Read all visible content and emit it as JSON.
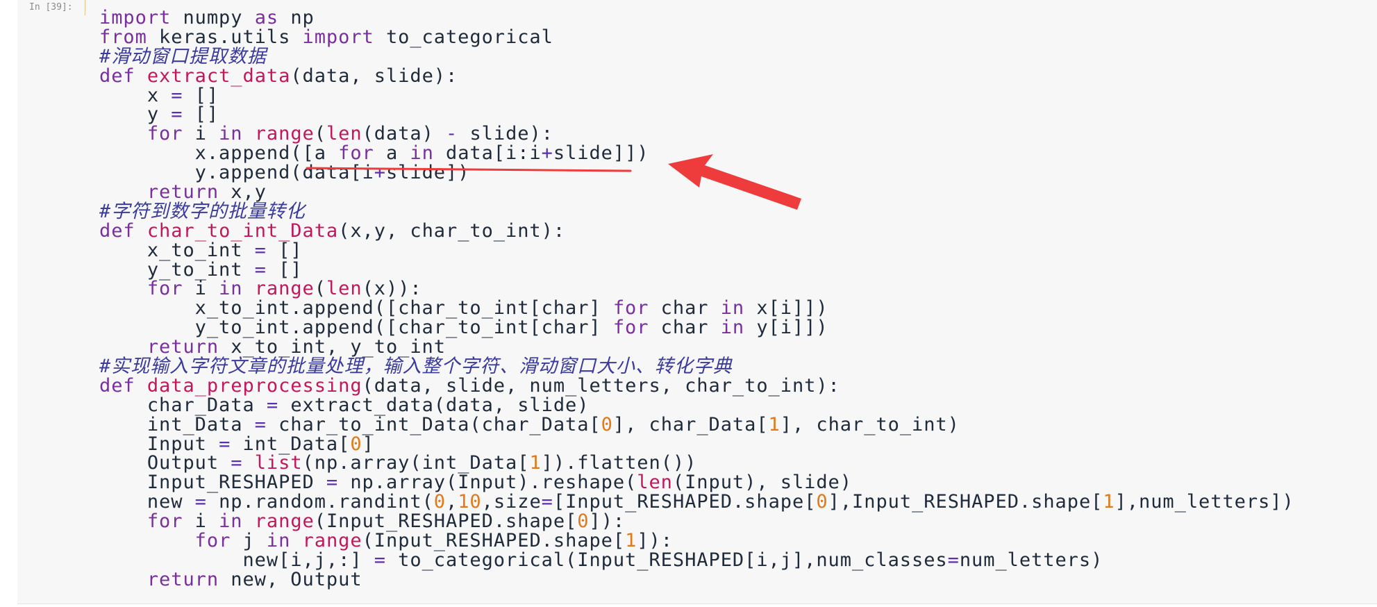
{
  "cell": {
    "prompt": "In [39]:"
  },
  "code_lines": [
    [
      {
        "t": "kw",
        "s": "import"
      },
      {
        "t": "",
        "s": " numpy "
      },
      {
        "t": "kw",
        "s": "as"
      },
      {
        "t": "",
        "s": " np"
      }
    ],
    [
      {
        "t": "kw",
        "s": "from"
      },
      {
        "t": "",
        "s": " keras.utils "
      },
      {
        "t": "kw",
        "s": "import"
      },
      {
        "t": "",
        "s": " to_categorical"
      }
    ],
    [
      {
        "t": "cm",
        "s": "#滑动窗口提取数据"
      }
    ],
    [
      {
        "t": "kw",
        "s": "def"
      },
      {
        "t": "",
        "s": " "
      },
      {
        "t": "fn",
        "s": "extract_data"
      },
      {
        "t": "",
        "s": "(data, slide):"
      }
    ],
    [
      {
        "t": "",
        "s": "    x "
      },
      {
        "t": "op",
        "s": "="
      },
      {
        "t": "",
        "s": " []"
      }
    ],
    [
      {
        "t": "",
        "s": "    y "
      },
      {
        "t": "op",
        "s": "="
      },
      {
        "t": "",
        "s": " []"
      }
    ],
    [
      {
        "t": "",
        "s": "    "
      },
      {
        "t": "kw",
        "s": "for"
      },
      {
        "t": "",
        "s": " i "
      },
      {
        "t": "kw",
        "s": "in"
      },
      {
        "t": "",
        "s": " "
      },
      {
        "t": "bi",
        "s": "range"
      },
      {
        "t": "",
        "s": "("
      },
      {
        "t": "bi",
        "s": "len"
      },
      {
        "t": "",
        "s": "(data) "
      },
      {
        "t": "op",
        "s": "-"
      },
      {
        "t": "",
        "s": " slide):"
      }
    ],
    [
      {
        "t": "",
        "s": "        x.append([a "
      },
      {
        "t": "kw",
        "s": "for"
      },
      {
        "t": "",
        "s": " a "
      },
      {
        "t": "kw",
        "s": "in"
      },
      {
        "t": "",
        "s": " data[i:i"
      },
      {
        "t": "op",
        "s": "+"
      },
      {
        "t": "",
        "s": "slide]])"
      }
    ],
    [
      {
        "t": "",
        "s": "        y.append(data[i"
      },
      {
        "t": "op",
        "s": "+"
      },
      {
        "t": "",
        "s": "slide])"
      }
    ],
    [
      {
        "t": "",
        "s": "    "
      },
      {
        "t": "kw",
        "s": "return"
      },
      {
        "t": "",
        "s": " x,y"
      }
    ],
    [
      {
        "t": "cm",
        "s": "#字符到数字的批量转化"
      }
    ],
    [
      {
        "t": "kw",
        "s": "def"
      },
      {
        "t": "",
        "s": " "
      },
      {
        "t": "fn",
        "s": "char_to_int_Data"
      },
      {
        "t": "",
        "s": "(x,y, char_to_int):"
      }
    ],
    [
      {
        "t": "",
        "s": "    x_to_int "
      },
      {
        "t": "op",
        "s": "="
      },
      {
        "t": "",
        "s": " []"
      }
    ],
    [
      {
        "t": "",
        "s": "    y_to_int "
      },
      {
        "t": "op",
        "s": "="
      },
      {
        "t": "",
        "s": " []"
      }
    ],
    [
      {
        "t": "",
        "s": "    "
      },
      {
        "t": "kw",
        "s": "for"
      },
      {
        "t": "",
        "s": " i "
      },
      {
        "t": "kw",
        "s": "in"
      },
      {
        "t": "",
        "s": " "
      },
      {
        "t": "bi",
        "s": "range"
      },
      {
        "t": "",
        "s": "("
      },
      {
        "t": "bi",
        "s": "len"
      },
      {
        "t": "",
        "s": "(x)):"
      }
    ],
    [
      {
        "t": "",
        "s": "        x_to_int.append([char_to_int[char] "
      },
      {
        "t": "kw",
        "s": "for"
      },
      {
        "t": "",
        "s": " char "
      },
      {
        "t": "kw",
        "s": "in"
      },
      {
        "t": "",
        "s": " x[i]])"
      }
    ],
    [
      {
        "t": "",
        "s": "        y_to_int.append([char_to_int[char] "
      },
      {
        "t": "kw",
        "s": "for"
      },
      {
        "t": "",
        "s": " char "
      },
      {
        "t": "kw",
        "s": "in"
      },
      {
        "t": "",
        "s": " y[i]])"
      }
    ],
    [
      {
        "t": "",
        "s": "    "
      },
      {
        "t": "kw",
        "s": "return"
      },
      {
        "t": "",
        "s": " x_to_int, y_to_int"
      }
    ],
    [
      {
        "t": "cm",
        "s": "#实现输入字符文章的批量处理，输入整个字符、滑动窗口大小、转化字典"
      }
    ],
    [
      {
        "t": "kw",
        "s": "def"
      },
      {
        "t": "",
        "s": " "
      },
      {
        "t": "fn",
        "s": "data_preprocessing"
      },
      {
        "t": "",
        "s": "(data, slide, num_letters, char_to_int):"
      }
    ],
    [
      {
        "t": "",
        "s": "    char_Data "
      },
      {
        "t": "op",
        "s": "="
      },
      {
        "t": "",
        "s": " extract_data(data, slide)"
      }
    ],
    [
      {
        "t": "",
        "s": "    int_Data "
      },
      {
        "t": "op",
        "s": "="
      },
      {
        "t": "",
        "s": " char_to_int_Data(char_Data["
      },
      {
        "t": "num",
        "s": "0"
      },
      {
        "t": "",
        "s": "], char_Data["
      },
      {
        "t": "num",
        "s": "1"
      },
      {
        "t": "",
        "s": "], char_to_int)"
      }
    ],
    [
      {
        "t": "",
        "s": "    Input "
      },
      {
        "t": "op",
        "s": "="
      },
      {
        "t": "",
        "s": " int_Data["
      },
      {
        "t": "num",
        "s": "0"
      },
      {
        "t": "",
        "s": "]"
      }
    ],
    [
      {
        "t": "",
        "s": "    Output "
      },
      {
        "t": "op",
        "s": "="
      },
      {
        "t": "",
        "s": " "
      },
      {
        "t": "bi",
        "s": "list"
      },
      {
        "t": "",
        "s": "(np.array(int_Data["
      },
      {
        "t": "num",
        "s": "1"
      },
      {
        "t": "",
        "s": "]).flatten())"
      }
    ],
    [
      {
        "t": "",
        "s": "    Input_RESHAPED "
      },
      {
        "t": "op",
        "s": "="
      },
      {
        "t": "",
        "s": " np.array(Input).reshape("
      },
      {
        "t": "bi",
        "s": "len"
      },
      {
        "t": "",
        "s": "(Input), slide)"
      }
    ],
    [
      {
        "t": "",
        "s": "    new "
      },
      {
        "t": "op",
        "s": "="
      },
      {
        "t": "",
        "s": " np.random.randint("
      },
      {
        "t": "num",
        "s": "0"
      },
      {
        "t": "",
        "s": ","
      },
      {
        "t": "num",
        "s": "10"
      },
      {
        "t": "",
        "s": ",size"
      },
      {
        "t": "op",
        "s": "="
      },
      {
        "t": "",
        "s": "[Input_RESHAPED.shape["
      },
      {
        "t": "num",
        "s": "0"
      },
      {
        "t": "",
        "s": "],Input_RESHAPED.shape["
      },
      {
        "t": "num",
        "s": "1"
      },
      {
        "t": "",
        "s": "],num_letters])"
      }
    ],
    [
      {
        "t": "",
        "s": "    "
      },
      {
        "t": "kw",
        "s": "for"
      },
      {
        "t": "",
        "s": " i "
      },
      {
        "t": "kw",
        "s": "in"
      },
      {
        "t": "",
        "s": " "
      },
      {
        "t": "bi",
        "s": "range"
      },
      {
        "t": "",
        "s": "(Input_RESHAPED.shape["
      },
      {
        "t": "num",
        "s": "0"
      },
      {
        "t": "",
        "s": "]):"
      }
    ],
    [
      {
        "t": "",
        "s": "        "
      },
      {
        "t": "kw",
        "s": "for"
      },
      {
        "t": "",
        "s": " j "
      },
      {
        "t": "kw",
        "s": "in"
      },
      {
        "t": "",
        "s": " "
      },
      {
        "t": "bi",
        "s": "range"
      },
      {
        "t": "",
        "s": "(Input_RESHAPED.shape["
      },
      {
        "t": "num",
        "s": "1"
      },
      {
        "t": "",
        "s": "]):"
      }
    ],
    [
      {
        "t": "",
        "s": "            new[i,j,:] "
      },
      {
        "t": "op",
        "s": "="
      },
      {
        "t": "",
        "s": " to_categorical(Input_RESHAPED[i,j],num_classes"
      },
      {
        "t": "op",
        "s": "="
      },
      {
        "t": "",
        "s": "num_letters)"
      }
    ],
    [
      {
        "t": "",
        "s": "    "
      },
      {
        "t": "kw",
        "s": "return"
      },
      {
        "t": "",
        "s": " new, Output"
      }
    ]
  ],
  "annotation": {
    "color": "#ee3b3b",
    "target_line": 7
  }
}
